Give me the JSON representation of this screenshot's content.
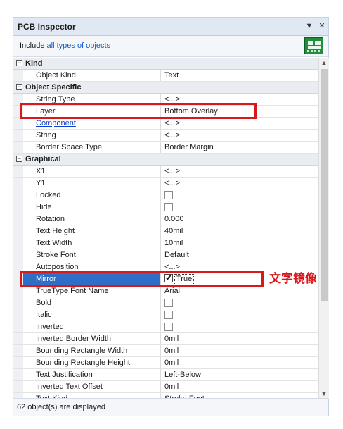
{
  "panel": {
    "title": "PCB Inspector",
    "pin_glyph": "▼",
    "close_glyph": "✕",
    "include_prefix": "Include",
    "include_link": "all types of objects",
    "filter_icon": "pcb-board-icon",
    "status": "62 object(s) are displayed"
  },
  "groups": [
    {
      "label": "Kind",
      "rows": [
        {
          "name": "Object Kind",
          "value": "Text"
        }
      ]
    },
    {
      "label": "Object Specific",
      "rows": [
        {
          "name": "String Type",
          "value": "<...>"
        },
        {
          "name": "Layer",
          "value": "Bottom Overlay"
        },
        {
          "name": "Component",
          "value": "<...>",
          "link": true
        },
        {
          "name": "String",
          "value": "<...>"
        },
        {
          "name": "Border Space Type",
          "value": "Border Margin"
        }
      ]
    },
    {
      "label": "Graphical",
      "rows": [
        {
          "name": "X1",
          "value": "<...>"
        },
        {
          "name": "Y1",
          "value": "<...>"
        },
        {
          "name": "Locked",
          "checkbox": true
        },
        {
          "name": "Hide",
          "checkbox": true
        },
        {
          "name": "Rotation",
          "value": "0.000"
        },
        {
          "name": "Text Height",
          "value": "40mil"
        },
        {
          "name": "Text Width",
          "value": "10mil"
        },
        {
          "name": "Stroke Font",
          "value": "Default"
        },
        {
          "name": "Autoposition",
          "value": "<...>"
        },
        {
          "name": "Mirror",
          "value": "True",
          "checkbox": true,
          "checked": true,
          "selected": true
        },
        {
          "name": "TrueType Font Name",
          "value": "Arial"
        },
        {
          "name": "Bold",
          "checkbox": true
        },
        {
          "name": "Italic",
          "checkbox": true
        },
        {
          "name": "Inverted",
          "checkbox": true
        },
        {
          "name": "Inverted Border Width",
          "value": "0mil"
        },
        {
          "name": "Bounding Rectangle Width",
          "value": "0mil"
        },
        {
          "name": "Bounding Rectangle Height",
          "value": "0mil"
        },
        {
          "name": "Text Justification",
          "value": "Left-Below"
        },
        {
          "name": "Inverted Text Offset",
          "value": "0mil"
        },
        {
          "name": "Text Kind",
          "value": "Stroke Font"
        }
      ]
    }
  ],
  "annotation": {
    "text": "文字镜像",
    "color": "#d7191c"
  },
  "colors": {
    "selection": "#2f6ec6",
    "highlight": "#d7191c",
    "titlebar": "#dfe8f3"
  }
}
